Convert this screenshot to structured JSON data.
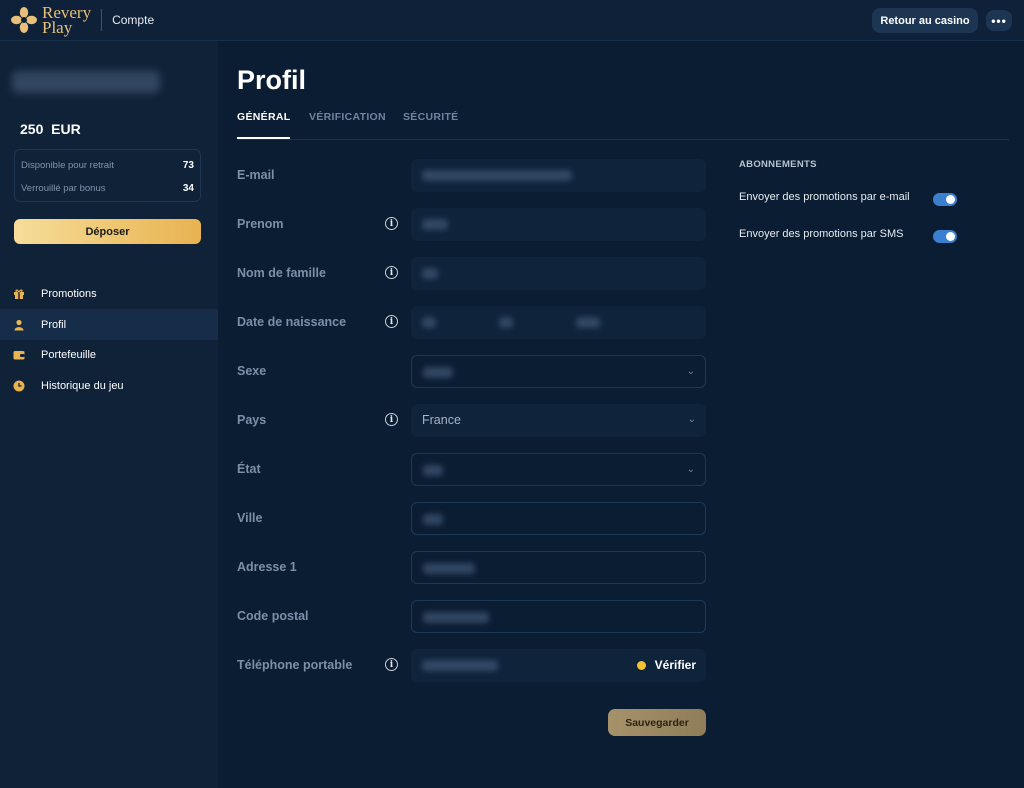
{
  "header": {
    "logo_line1": "Revery",
    "logo_line2": "Play",
    "section": "Compte",
    "back_button": "Retour au casino",
    "more_button": "•••"
  },
  "sidebar": {
    "balance": "250  EUR",
    "withdrawable_label": "Disponible pour retrait",
    "withdrawable_value": "73",
    "bonus_locked_label": "Verrouillé par bonus",
    "bonus_locked_value": "34",
    "deposit_button": "Déposer",
    "nav": [
      {
        "label": "Promotions",
        "icon": "gift-icon"
      },
      {
        "label": "Profil",
        "icon": "user-icon",
        "active": true
      },
      {
        "label": "Portefeuille",
        "icon": "wallet-icon"
      },
      {
        "label": "Historique du jeu",
        "icon": "clock-icon"
      }
    ]
  },
  "main": {
    "title": "Profil",
    "tabs": [
      {
        "label": "GÉNÉRAL",
        "active": true
      },
      {
        "label": "VÉRIFICATION"
      },
      {
        "label": "SÉCURITÉ"
      }
    ],
    "fields": {
      "email": "E-mail",
      "prenom": "Prenom",
      "nom": "Nom de famille",
      "naissance": "Date de naissance",
      "sexe": "Sexe",
      "pays": "Pays",
      "pays_value": "France",
      "etat": "État",
      "ville": "Ville",
      "adresse": "Adresse 1",
      "code_postal": "Code postal",
      "telephone": "Téléphone portable"
    },
    "verify_button": "Vérifier",
    "save_button": "Sauvegarder"
  },
  "subscriptions": {
    "title": "ABONNEMENTS",
    "email_promo": "Envoyer des promotions par e-mail",
    "sms_promo": "Envoyer des promotions par SMS",
    "email_enabled": true,
    "sms_enabled": true
  },
  "colors": {
    "accent_gold": "#e8b350",
    "toggle_blue": "#3b7fd1",
    "background": "#0b1d33"
  }
}
